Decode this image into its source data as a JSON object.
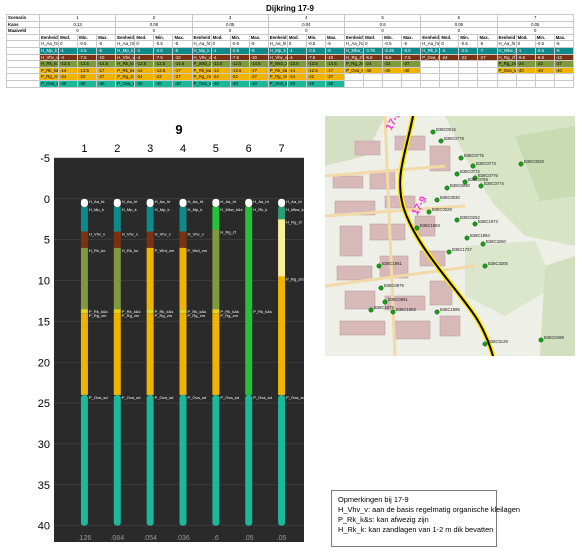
{
  "table": {
    "title": "Dijkring 17-9",
    "row_labels": {
      "scenario": "Scenario",
      "kans": "Kans",
      "maaiveld": "Maaiveld"
    },
    "sub_headers": [
      "Eenheid",
      "Mod.",
      "Min.",
      "Max."
    ],
    "scenarios": [
      {
        "id": "1",
        "kans": "0.13",
        "maaiveld": "0",
        "rows": [
          [
            "H_Aa_ht",
            "0",
            "-0.5",
            "-5"
          ],
          [
            "H_Mp_k",
            "-1",
            "-2.5",
            "-5"
          ],
          [
            "H_Vhv_v",
            "-4",
            "-7.5",
            "-10"
          ],
          [
            "H_Rk_ko",
            "-13.5",
            "-12.5",
            "-14.5"
          ],
          [
            "P_Rk_k&s",
            "-14",
            "-12.5",
            "-17"
          ],
          [
            "P_Rg_zm",
            "-24",
            "-22",
            "-27"
          ],
          [
            "P_Ova_sd",
            "-40",
            "-40",
            "-40"
          ]
        ]
      },
      {
        "id": "2",
        "kans": "0.08",
        "maaiveld": "0",
        "rows": [
          [
            "H_Aa_ht",
            "0",
            "-0.5",
            "-5"
          ],
          [
            "H_Mp_k",
            "-1",
            "-2.5",
            "-5"
          ],
          [
            "H_Vhv_v",
            "-4",
            "-7.5",
            "-10"
          ],
          [
            "H_Rk_ko",
            "-13.5",
            "-12.5",
            "-14.5"
          ],
          [
            "P_Rk_k&s",
            "-14",
            "-12.5",
            "-17"
          ],
          [
            "P_Rg_zm",
            "-24",
            "-22",
            "-27"
          ],
          [
            "P_Ova_sd",
            "-40",
            "-40",
            "-40"
          ]
        ]
      },
      {
        "id": "3",
        "kans": "0.05",
        "maaiveld": "0",
        "rows": [
          [
            "H_Aa_ht",
            "0",
            "-0.5",
            "-5"
          ],
          [
            "H_Mp_k",
            "-1",
            "-2.5",
            "-5"
          ],
          [
            "H_Vhv_v",
            "-4",
            "-7.5",
            "-10"
          ],
          [
            "P_Wrd_zm",
            "-13.5",
            "-12.5",
            "-14.5"
          ],
          [
            "P_Rk_k&s",
            "-14",
            "-12.5",
            "-17"
          ],
          [
            "P_Rg_zm",
            "-24",
            "-22",
            "-27"
          ],
          [
            "P_Ova_sd",
            "-40",
            "-40",
            "-40"
          ]
        ]
      },
      {
        "id": "4",
        "kans": "0.04",
        "maaiveld": "0",
        "rows": [
          [
            "H_Aa_ht",
            "0",
            "-0.5",
            "-5"
          ],
          [
            "H_Mp_k",
            "-1",
            "-2.5",
            "-5"
          ],
          [
            "H_Vhv_v",
            "-4",
            "-7.5",
            "-10"
          ],
          [
            "P_Wrd_zm",
            "-13.5",
            "-12.5",
            "-14.5"
          ],
          [
            "P_Rk_k&s",
            "-14",
            "-12.5",
            "-17"
          ],
          [
            "P_Rg_zm",
            "-24",
            "-22",
            "-27"
          ],
          [
            "P_Ova_sd",
            "-40",
            "-40",
            "-40"
          ]
        ]
      },
      {
        "id": "5",
        "kans": "0.6",
        "maaiveld": "0",
        "rows": [
          [
            "H_Aa_ht",
            "0",
            "-0.5",
            "-5"
          ],
          [
            "H_Mkw_k&z",
            "-3.75",
            "-2.25",
            "-5.5"
          ],
          [
            "H_Rg_zf",
            "-6.5",
            "-5.5",
            "-7.5"
          ],
          [
            "P_Rg_zm",
            "-24",
            "-22",
            "-27"
          ],
          [
            "P_Ova_sd",
            "-40",
            "-40",
            "-40"
          ],
          [
            "",
            "",
            " ",
            ""
          ],
          [
            "",
            "",
            "",
            ""
          ]
        ]
      },
      {
        "id": "6",
        "kans": "0.05",
        "maaiveld": "0",
        "rows": [
          [
            "H_Aa_ht",
            "0",
            "-0.5",
            "-5"
          ],
          [
            "H_Rk_k",
            "-4",
            "-2.5",
            "-7"
          ],
          [
            "P_Ova_sd",
            "-24",
            "-22",
            "-27"
          ],
          [
            "",
            "",
            "",
            ""
          ],
          [
            "",
            "",
            "",
            ""
          ],
          [
            "",
            "",
            "",
            ""
          ],
          [
            "",
            "",
            "",
            ""
          ]
        ]
      },
      {
        "id": "7",
        "kans": "0.05",
        "maaiveld": "0",
        "rows": [
          [
            "H_Aa_ht",
            "0",
            "-0.5",
            "-5"
          ],
          [
            "H_Mkw_k&z",
            "-1",
            "-0.5",
            "-5"
          ],
          [
            "H_Rg_zf",
            "-9.5",
            "-8.5",
            "-12"
          ],
          [
            "P_Rg_zm",
            "-24",
            "-22",
            "-27"
          ],
          [
            "P_Ova_sd",
            "-40",
            "-40",
            "-40"
          ],
          [
            "",
            "",
            "",
            ""
          ],
          [
            "",
            "",
            "",
            ""
          ]
        ]
      }
    ]
  },
  "chart_data": {
    "type": "bar",
    "title": "9",
    "ylim": [
      -5,
      42
    ],
    "y_inverted": true,
    "y_ticks": [
      "-5",
      "0",
      "5",
      "10",
      "15",
      "20",
      "25",
      "30",
      "35",
      "40"
    ],
    "y_tick_values": [
      -5,
      0,
      5,
      10,
      15,
      20,
      25,
      30,
      35,
      40
    ],
    "categories": [
      "1",
      "2",
      "3",
      "4",
      "5",
      "6",
      "7"
    ],
    "probabilities": [
      ".126",
      ".084",
      ".054",
      ".036",
      ".6",
      ".05",
      ".05"
    ],
    "columns": [
      {
        "name": "1",
        "layers": [
          {
            "label": "H_Aa_ht",
            "top": 0,
            "bottom": 1,
            "color": "#ffffff"
          },
          {
            "label": "H_Mp_k",
            "top": 1,
            "bottom": 4,
            "color": "#0f8a8a"
          },
          {
            "label": "H_Vhv_v",
            "top": 4,
            "bottom": 6,
            "color": "#7a3210"
          },
          {
            "label": "H_Rk_ko",
            "top": 6,
            "bottom": 13.5,
            "color": "#7f9a3c"
          },
          {
            "label": "P_Rk_k&s",
            "top": 13.5,
            "bottom": 14,
            "color": "#e6d020"
          },
          {
            "label": "P_Rg_zm",
            "top": 14,
            "bottom": 24,
            "color": "#f0b400"
          },
          {
            "label": "P_Ova_sd",
            "top": 24,
            "bottom": 40,
            "color": "#1bb89a"
          }
        ]
      },
      {
        "name": "2",
        "layers": [
          {
            "label": "H_Aa_ht",
            "top": 0,
            "bottom": 1,
            "color": "#ffffff"
          },
          {
            "label": "H_Mp_k",
            "top": 1,
            "bottom": 4,
            "color": "#0f8a8a"
          },
          {
            "label": "H_Vhv_v",
            "top": 4,
            "bottom": 6,
            "color": "#7a3210"
          },
          {
            "label": "H_Rk_ko",
            "top": 6,
            "bottom": 13.5,
            "color": "#7f9a3c"
          },
          {
            "label": "P_Rk_k&s",
            "top": 13.5,
            "bottom": 14,
            "color": "#e6d020"
          },
          {
            "label": "P_Rg_zm",
            "top": 14,
            "bottom": 24,
            "color": "#f0b400"
          },
          {
            "label": "P_Ova_sd",
            "top": 24,
            "bottom": 40,
            "color": "#1bb89a"
          }
        ]
      },
      {
        "name": "3",
        "layers": [
          {
            "label": "H_Aa_ht",
            "top": 0,
            "bottom": 1,
            "color": "#ffffff"
          },
          {
            "label": "H_Mp_k",
            "top": 1,
            "bottom": 4,
            "color": "#0f8a8a"
          },
          {
            "label": "H_Vhv_v",
            "top": 4,
            "bottom": 6,
            "color": "#7a3210"
          },
          {
            "label": "P_Wrd_zm",
            "top": 6,
            "bottom": 13.5,
            "color": "#f0b400"
          },
          {
            "label": "P_Rk_k&s",
            "top": 13.5,
            "bottom": 14,
            "color": "#e6d020"
          },
          {
            "label": "P_Rg_zm",
            "top": 14,
            "bottom": 24,
            "color": "#f0b400"
          },
          {
            "label": "P_Ova_sd",
            "top": 24,
            "bottom": 40,
            "color": "#1bb89a"
          }
        ]
      },
      {
        "name": "4",
        "layers": [
          {
            "label": "H_Aa_ht",
            "top": 0,
            "bottom": 1,
            "color": "#ffffff"
          },
          {
            "label": "H_Mp_k",
            "top": 1,
            "bottom": 4,
            "color": "#0f8a8a"
          },
          {
            "label": "H_Vhv_v",
            "top": 4,
            "bottom": 6,
            "color": "#7a3210"
          },
          {
            "label": "P_Wrd_zm",
            "top": 6,
            "bottom": 13.5,
            "color": "#f0b400"
          },
          {
            "label": "P_Rk_k&s",
            "top": 13.5,
            "bottom": 14,
            "color": "#e6d020"
          },
          {
            "label": "P_Rg_zm",
            "top": 14,
            "bottom": 24,
            "color": "#f0b400"
          },
          {
            "label": "P_Ova_sd",
            "top": 24,
            "bottom": 40,
            "color": "#1bb89a"
          }
        ]
      },
      {
        "name": "5",
        "layers": [
          {
            "label": "H_Aa_ht",
            "top": 0,
            "bottom": 1,
            "color": "#ffffff"
          },
          {
            "label": "H_Mkw_k&z",
            "top": 1,
            "bottom": 3.75,
            "color": "#23c23a"
          },
          {
            "label": "H_Rg_zf",
            "top": 3.75,
            "bottom": 13.5,
            "color": "#7f9a3c"
          },
          {
            "label": "P_Rk_k&s",
            "top": 13.5,
            "bottom": 14,
            "color": "#e6d020"
          },
          {
            "label": "P_Rg_zm",
            "top": 14,
            "bottom": 24,
            "color": "#f0b400"
          },
          {
            "label": "P_Ova_sd",
            "top": 24,
            "bottom": 40,
            "color": "#1bb89a"
          }
        ]
      },
      {
        "name": "6",
        "layers": [
          {
            "label": "H_Aa_ht",
            "top": 0,
            "bottom": 1,
            "color": "#ffffff"
          },
          {
            "label": "H_Rk_k",
            "top": 1,
            "bottom": 13.5,
            "color": "#23c23a"
          },
          {
            "label": "P_Rk_k&s",
            "top": 13.5,
            "bottom": 24,
            "color": "#23c23a"
          },
          {
            "label": "P_Ova_sd",
            "top": 24,
            "bottom": 40,
            "color": "#1bb89a"
          }
        ]
      },
      {
        "name": "7",
        "layers": [
          {
            "label": "H_Aa_ht",
            "top": 0,
            "bottom": 1,
            "color": "#ffffff"
          },
          {
            "label": "H_Mkw_k&z",
            "top": 1,
            "bottom": 2.5,
            "color": "#2a9d7a"
          },
          {
            "label": "H_Rg_zf",
            "top": 2.5,
            "bottom": 9.5,
            "color": "#f8ef9a"
          },
          {
            "label": "P_Rg_zm",
            "top": 9.5,
            "bottom": 24,
            "color": "#f0b400"
          },
          {
            "label": "P_Ova_sd",
            "top": 24,
            "bottom": 40,
            "color": "#1bb89a"
          }
        ]
      }
    ],
    "column_labels": [
      [
        "H_Aa_ht",
        "H_Mp_k",
        "H_Vhv_v",
        "H_Rk_ko",
        "P_Rk_k&s",
        "P_Rg_zm",
        "P_Ova_sd"
      ],
      [
        "H_Aa_ht",
        "H_Mp_k",
        "H_Vhv_v",
        "H_Rk_ko",
        "P_Rk_k&s",
        "P_Rg_zm",
        "P_Ova_sd"
      ],
      [
        "H_Aa_ht",
        "H_Mp_k",
        "H_Vhv_v",
        "P_Wrd_zm",
        "P_Rk_k&s",
        "P_Rg_zm",
        "P_Ova_sd"
      ],
      [
        "H_Aa_ht",
        "H_Mp_k",
        "H_Vhv_v",
        "P_Wrd_zm",
        "P_Rk_k&s",
        "P_Rg_zm",
        "P_Ova_sd"
      ],
      [
        "H_Aa_ht",
        "H_Mkw_k&z",
        "H_Rg_zf",
        "P_Rk_k&s",
        "P_Rg_zm",
        "P_Ova_sd"
      ],
      [
        "H_Aa_ht",
        "H_Rk_k",
        "P_Rk_k&s",
        "P_Ova_sd"
      ],
      [
        "H_Aa_ht",
        "H_Mkw_k&z",
        "H_Rg_zf",
        "P_Rg_zm",
        "P_Ova_sd"
      ]
    ],
    "colors": {
      "background": "#2a2a2a",
      "grid": "#444444",
      "text": "#ffffff"
    }
  },
  "map": {
    "dike_label": "17-9",
    "points": [
      "B38C0015",
      "B38C0778",
      "B38C0028",
      "B38C0775",
      "B38C0773",
      "B38C0776",
      "B38C0772",
      "B38C0769",
      "B38C0774",
      "B38C0090",
      "B38C0030",
      "B38C0029",
      "B38C1993",
      "B38C0252",
      "B38C1973",
      "B38C3250",
      "B38C1994",
      "B38C1727",
      "B38C3205",
      "B38C1961",
      "B38C0979",
      "B38C0991",
      "B38C1903",
      "B38C1879",
      "B38C1695",
      "B38C0498",
      "B38C5128"
    ],
    "colors": {
      "dike": "#000000",
      "dike_label": "#ff2fd0",
      "points": "#18a018"
    }
  },
  "remarks": {
    "title": "Opmerkingen bij 17-9",
    "lines": [
      "H_Vhv_v: aan de basis regelmatig organische kleilagen",
      "P_Rk_k&s: kan afwezig zijn",
      "H_Rk_k: kan zandlagen van 1-2 m dik bevatten"
    ]
  }
}
